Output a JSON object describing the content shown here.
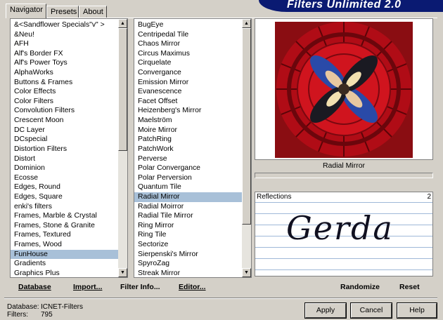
{
  "tabs": [
    {
      "label": "Navigator"
    },
    {
      "label": "Presets"
    },
    {
      "label": "About"
    }
  ],
  "banner": {
    "title": "Filters Unlimited 2.0"
  },
  "categories": {
    "items": [
      "&<Sandflower Specials\"v\" >",
      "&Neu!",
      "AFH",
      "Alf's Border FX",
      "Alf's Power Toys",
      "AlphaWorks",
      "Buttons & Frames",
      "Color Effects",
      "Color Filters",
      "Convolution Filters",
      "Crescent Moon",
      "DC Layer",
      "DCspecial",
      "Distortion Filters",
      "Distort",
      "Dominion",
      "Ecosse",
      "Edges, Round",
      "Edges, Square",
      "enki's filters",
      "Frames, Marble & Crystal",
      "Frames, Stone & Granite",
      "Frames, Textured",
      "Frames, Wood",
      "FunHouse",
      "Gradients",
      "Graphics Plus"
    ],
    "selected": "FunHouse"
  },
  "filters": {
    "items": [
      "BugEye",
      "Centripedal Tile",
      "Chaos Mirror",
      "Circus Maximus",
      "Cirquelate",
      "Convergance",
      "Emission Mirror",
      "Evanescence",
      "Facet Offset",
      "Heizenberg's Mirror",
      "Maelström",
      "Moire Mirror",
      "PatchRing",
      "PatchWork",
      "Perverse",
      "Polar Convergance",
      "Polar Perversion",
      "Quantum Tile",
      "Radial Mirror",
      "Radial Moirror",
      "Radial Tile Mirror",
      "Ring Mirror",
      "Ring Tile",
      "Sectorize",
      "Sierpenski's Mirror",
      "SpyroZag",
      "Streak Mirror"
    ],
    "selected": "Radial Mirror"
  },
  "preview": {
    "filter_name": "Radial Mirror"
  },
  "parameters": {
    "label": "Reflections",
    "value": "2",
    "watermark": "Gerda"
  },
  "toolbar": {
    "database": "Database",
    "import": "Import...",
    "filter_info": "Filter Info...",
    "editor": "Editor...",
    "randomize": "Randomize",
    "reset": "Reset"
  },
  "status": {
    "database_label": "Database:",
    "database_value": "ICNET-Filters",
    "filters_label": "Filters:",
    "filters_value": "795"
  },
  "buttons": {
    "apply": "Apply",
    "cancel": "Cancel",
    "help": "Help"
  },
  "colors": {
    "banner": "#0a1a72",
    "selection": "#a8c0d8",
    "preview_red": "#c8101a",
    "param_lines": "#9fb8d8"
  }
}
